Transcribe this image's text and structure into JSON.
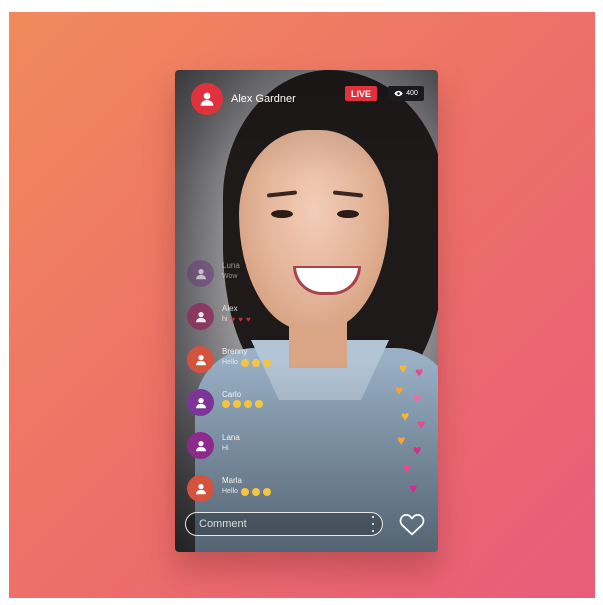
{
  "header": {
    "host_name": "Alex Gardner",
    "live_label": "LIVE",
    "viewer_count": "400"
  },
  "comments": [
    {
      "name": "Luna",
      "message": "Wow",
      "avatar_color": "#6a3a7a",
      "extra": "none"
    },
    {
      "name": "Alex",
      "message": "hi",
      "avatar_color": "#8e2f5e",
      "extra": "hearts"
    },
    {
      "name": "Brenny",
      "message": "Hello",
      "avatar_color": "#d3533e",
      "extra": "emojis"
    },
    {
      "name": "Carlo",
      "message": "",
      "avatar_color": "#7b3596",
      "extra": "emojis"
    },
    {
      "name": "Lana",
      "message": "Hi",
      "avatar_color": "#8e2a8e",
      "extra": "none"
    },
    {
      "name": "Marla",
      "message": "Hello",
      "avatar_color": "#d3533e",
      "extra": "emojis"
    }
  ],
  "footer": {
    "comment_placeholder": "Comment"
  },
  "colors": {
    "accent": "#e0323d",
    "background_start": "#f08a5c",
    "background_end": "#e85c7a"
  },
  "icons": {
    "host_avatar": "user-icon",
    "viewers": "eye-icon",
    "more": "more-vertical-icon",
    "like": "heart-outline-icon"
  }
}
